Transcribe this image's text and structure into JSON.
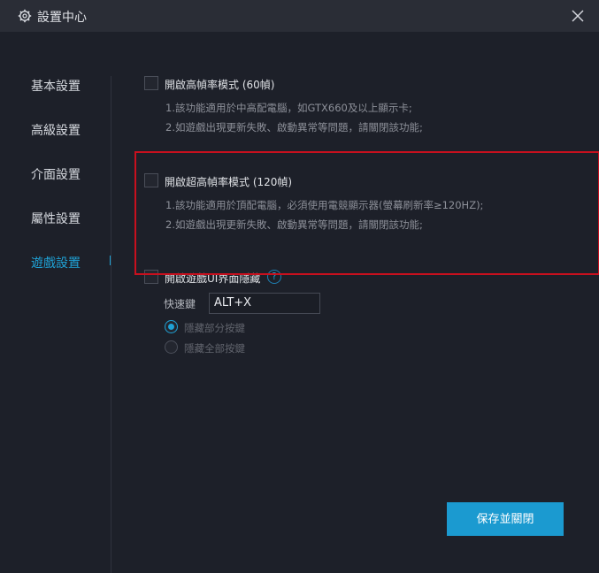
{
  "window": {
    "title": "設置中心",
    "settings_icon": "gear-icon",
    "close_icon": "close-icon"
  },
  "sidebar": {
    "items": [
      {
        "label": "基本設置",
        "active": false
      },
      {
        "label": "高級設置",
        "active": false
      },
      {
        "label": "介面設置",
        "active": false
      },
      {
        "label": "屬性設置",
        "active": false
      },
      {
        "label": "遊戲設置",
        "active": true
      }
    ]
  },
  "game_settings": {
    "high_fps": {
      "label": "開啟高幀率模式 (60幀)",
      "checked": false,
      "notes": [
        "1.該功能適用於中高配電腦，如GTX660及以上顯示卡;",
        "2.如遊戲出現更新失敗、啟動異常等問題，請關閉該功能;"
      ]
    },
    "ultra_fps": {
      "label": "開啟超高幀率模式 (120幀)",
      "checked": false,
      "notes": [
        "1.該功能適用於頂配電腦，必須使用電競顯示器(螢幕刷新率≥120HZ);",
        "2.如遊戲出現更新失敗、啟動異常等問題，請關閉該功能;"
      ]
    },
    "hide_ui": {
      "label": "開啟遊戲UI界面隱藏",
      "checked": false,
      "help_icon": "?",
      "hotkey_label": "快速鍵",
      "hotkey_value": "ALT+X",
      "options": [
        {
          "label": "隱藏部分按鍵",
          "selected": true
        },
        {
          "label": "隱藏全部按鍵",
          "selected": false
        }
      ]
    }
  },
  "footer": {
    "save_label": "保存並關閉"
  },
  "colors": {
    "accent": "#1fa2d6",
    "highlight": "#c8101e",
    "background": "#1d2029",
    "titlebar": "#2a2d36"
  }
}
